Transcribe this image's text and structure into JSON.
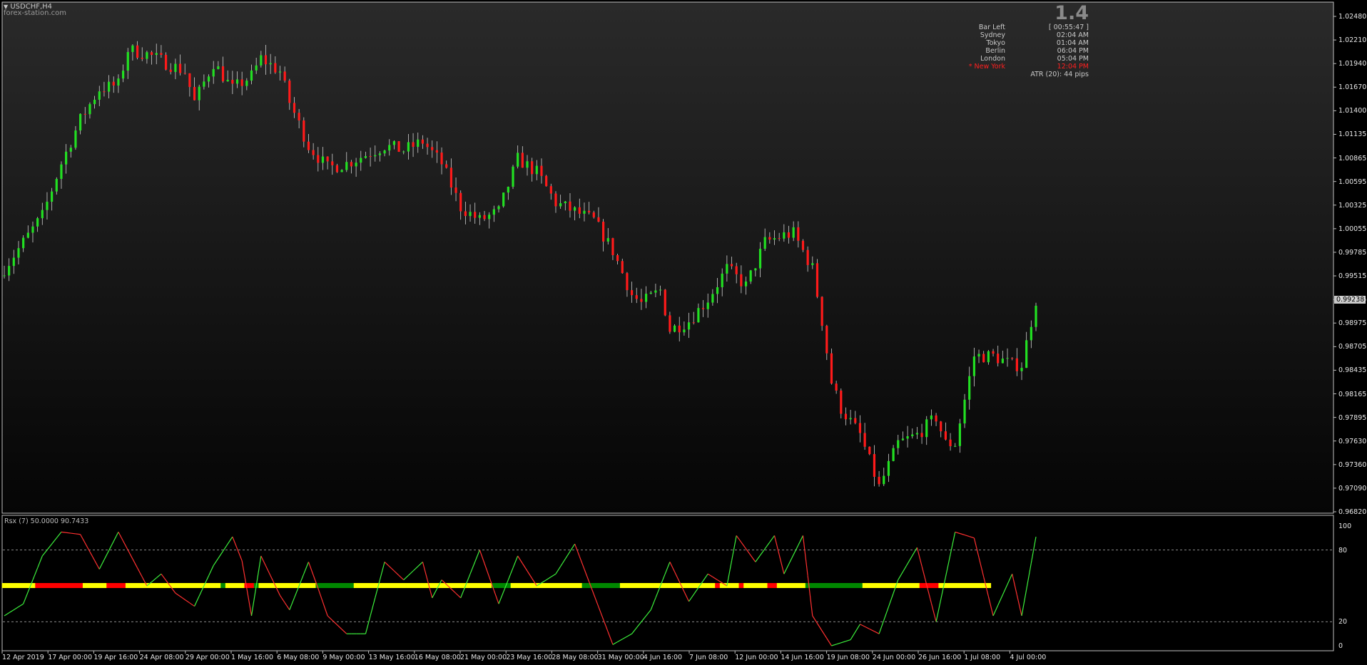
{
  "symbol_title": "USDCHF,H4",
  "watermark": "forex-station.com",
  "spread_value": "1.4",
  "info_panel": {
    "bar_left_label": "Bar Left",
    "bar_left_value": "[ 00:55:47 ]",
    "sessions": [
      {
        "city": "Sydney",
        "time": "02:04 AM",
        "active": false
      },
      {
        "city": "Tokyo",
        "time": "01:04 AM",
        "active": false
      },
      {
        "city": "Berlin",
        "time": "06:04 PM",
        "active": false
      },
      {
        "city": "London",
        "time": "05:04 PM",
        "active": false
      },
      {
        "city": "* New York",
        "time": "12:04 PM",
        "active": true
      }
    ],
    "atr_text": "ATR (20): 44 pips"
  },
  "price_axis": [
    "1.02480",
    "1.02210",
    "1.01940",
    "1.01670",
    "1.01400",
    "1.01135",
    "1.00865",
    "1.00595",
    "1.00325",
    "1.00055",
    "0.99785",
    "0.99515",
    "0.99245",
    "0.98975",
    "0.98705",
    "0.98435",
    "0.98165",
    "0.97895",
    "0.97630",
    "0.97360",
    "0.97090",
    "0.96820"
  ],
  "current_price": "0.99238",
  "indicator": {
    "label": "Rsx (7) 50.0000 90.7433",
    "levels": [
      "100",
      "80",
      "20",
      "0"
    ]
  },
  "time_axis": [
    "12 Apr 2019",
    "17 Apr 00:00",
    "19 Apr 16:00",
    "24 Apr 08:00",
    "29 Apr 00:00",
    "1 May 16:00",
    "6 May 08:00",
    "9 May 00:00",
    "13 May 16:00",
    "16 May 08:00",
    "21 May 00:00",
    "23 May 16:00",
    "28 May 08:00",
    "31 May 00:00",
    "4 Jun 16:00",
    "7 Jun 08:00",
    "12 Jun 00:00",
    "14 Jun 16:00",
    "19 Jun 08:00",
    "24 Jun 00:00",
    "26 Jun 16:00",
    "1 Jul 08:00",
    "4 Jul 00:00"
  ],
  "colors": {
    "bull": "#22e022",
    "bear": "#ff1a1a",
    "rsx_up": "#3cf03c",
    "rsx_down": "#ff3030",
    "ribbon_yellow": "#ffff00",
    "ribbon_red": "#ff0000",
    "ribbon_green": "#008800"
  },
  "chart_data": {
    "type": "candlestick",
    "ylim": [
      0.9682,
      1.0248
    ],
    "close_path": [
      [
        0,
        0.996
      ],
      [
        4,
        0.999
      ],
      [
        8,
        1.002
      ],
      [
        12,
        1.008
      ],
      [
        16,
        1.013
      ],
      [
        20,
        1.0165
      ],
      [
        24,
        1.017
      ],
      [
        26,
        1.021
      ],
      [
        30,
        1.0205
      ],
      [
        34,
        1.0195
      ],
      [
        38,
        1.0185
      ],
      [
        40,
        1.015
      ],
      [
        44,
        1.0195
      ],
      [
        48,
        1.0165
      ],
      [
        52,
        1.018
      ],
      [
        54,
        1.02
      ],
      [
        58,
        1.0185
      ],
      [
        60,
        1.015
      ],
      [
        64,
        1.01
      ],
      [
        68,
        1.0075
      ],
      [
        72,
        1.008
      ],
      [
        76,
        1.009
      ],
      [
        80,
        1.01
      ],
      [
        84,
        1.0095
      ],
      [
        88,
        1.0105
      ],
      [
        92,
        1.008
      ],
      [
        96,
        1.003
      ],
      [
        100,
        1.0015
      ],
      [
        104,
        1.0025
      ],
      [
        108,
        1.0085
      ],
      [
        112,
        1.007
      ],
      [
        116,
        1.0035
      ],
      [
        120,
        1.0025
      ],
      [
        124,
        1.0015
      ],
      [
        128,
        0.998
      ],
      [
        132,
        0.993
      ],
      [
        134,
        0.992
      ],
      [
        138,
        0.9935
      ],
      [
        140,
        0.989
      ],
      [
        144,
        0.99
      ],
      [
        148,
        0.9925
      ],
      [
        152,
        0.996
      ],
      [
        156,
        0.994
      ],
      [
        160,
        0.999
      ],
      [
        164,
        0.9998
      ],
      [
        166,
        1.0
      ],
      [
        170,
        0.996
      ],
      [
        172,
        0.99
      ],
      [
        174,
        0.983
      ],
      [
        176,
        0.98
      ],
      [
        180,
        0.977
      ],
      [
        182,
        0.974
      ],
      [
        184,
        0.971
      ],
      [
        188,
        0.976
      ],
      [
        192,
        0.977
      ],
      [
        196,
        0.979
      ],
      [
        198,
        0.976
      ],
      [
        200,
        0.976
      ],
      [
        204,
        0.986
      ],
      [
        208,
        0.986
      ],
      [
        212,
        0.985
      ],
      [
        214,
        0.985
      ],
      [
        217,
        0.9924
      ]
    ],
    "bars": 218,
    "rsx": [
      [
        0,
        25
      ],
      [
        4,
        35
      ],
      [
        8,
        75
      ],
      [
        12,
        95
      ],
      [
        16,
        93
      ],
      [
        20,
        64
      ],
      [
        24,
        95
      ],
      [
        26,
        80
      ],
      [
        30,
        50
      ],
      [
        33,
        60
      ],
      [
        36,
        44
      ],
      [
        40,
        33
      ],
      [
        44,
        67
      ],
      [
        48,
        91
      ],
      [
        50,
        71
      ],
      [
        52,
        25
      ],
      [
        54,
        75
      ],
      [
        58,
        42
      ],
      [
        60,
        30
      ],
      [
        64,
        70
      ],
      [
        66,
        48
      ],
      [
        68,
        25
      ],
      [
        72,
        10
      ],
      [
        76,
        10
      ],
      [
        80,
        70
      ],
      [
        84,
        55
      ],
      [
        88,
        70
      ],
      [
        90,
        40
      ],
      [
        92,
        55
      ],
      [
        96,
        40
      ],
      [
        100,
        80
      ],
      [
        104,
        35
      ],
      [
        108,
        75
      ],
      [
        112,
        50
      ],
      [
        116,
        60
      ],
      [
        120,
        85
      ],
      [
        124,
        43
      ],
      [
        128,
        1
      ],
      [
        132,
        10
      ],
      [
        136,
        30
      ],
      [
        140,
        70
      ],
      [
        144,
        37
      ],
      [
        148,
        60
      ],
      [
        152,
        50
      ],
      [
        154,
        92
      ],
      [
        158,
        70
      ],
      [
        162,
        92
      ],
      [
        164,
        60
      ],
      [
        168,
        92
      ],
      [
        170,
        25
      ],
      [
        174,
        0
      ],
      [
        178,
        5
      ],
      [
        180,
        18
      ],
      [
        184,
        10
      ],
      [
        188,
        55
      ],
      [
        192,
        82
      ],
      [
        196,
        20
      ],
      [
        200,
        95
      ],
      [
        204,
        90
      ],
      [
        208,
        25
      ],
      [
        212,
        60
      ],
      [
        214,
        25
      ],
      [
        217,
        91
      ]
    ],
    "ribbon": [
      "Y",
      "Y",
      "Y",
      "Y",
      "Y",
      "Y",
      "Y",
      "R",
      "R",
      "R",
      "R",
      "R",
      "R",
      "R",
      "R",
      "R",
      "R",
      "Y",
      "Y",
      "Y",
      "Y",
      "Y",
      "R",
      "R",
      "R",
      "R",
      "Y",
      "Y",
      "Y",
      "Y",
      "Y",
      "Y",
      "Y",
      "Y",
      "Y",
      "Y",
      "Y",
      "Y",
      "Y",
      "Y",
      "Y",
      "Y",
      "Y",
      "Y",
      "Y",
      "Y",
      "G",
      "Y",
      "Y",
      "Y",
      "Y",
      "R",
      "R",
      "G",
      "Y",
      "Y",
      "Y",
      "Y",
      "Y",
      "Y",
      "Y",
      "Y",
      "Y",
      "Y",
      "Y",
      "Y",
      "G",
      "G",
      "G",
      "G",
      "G",
      "G",
      "G",
      "G",
      "Y",
      "Y",
      "Y",
      "Y",
      "Y",
      "Y",
      "Y",
      "Y",
      "Y",
      "Y",
      "Y",
      "Y",
      "Y",
      "Y",
      "Y",
      "Y",
      "Y",
      "Y",
      "Y",
      "Y",
      "Y",
      "Y",
      "Y",
      "Y",
      "Y",
      "Y",
      "Y",
      "Y",
      "Y",
      "G",
      "G",
      "G",
      "G",
      "Y",
      "Y",
      "Y",
      "Y",
      "Y",
      "Y",
      "Y",
      "Y",
      "Y",
      "Y",
      "Y",
      "Y",
      "Y",
      "Y",
      "Y",
      "G",
      "G",
      "G",
      "G",
      "G",
      "G",
      "G",
      "G",
      "Y",
      "Y",
      "Y",
      "Y",
      "Y",
      "Y",
      "Y",
      "Y",
      "Y",
      "Y",
      "Y",
      "Y",
      "Y",
      "Y",
      "Y",
      "Y",
      "Y",
      "Y",
      "Y",
      "Y",
      "R",
      "Y",
      "Y",
      "Y",
      "Y",
      "R",
      "Y",
      "Y",
      "Y",
      "Y",
      "Y",
      "R",
      "R",
      "Y",
      "Y",
      "Y",
      "Y",
      "Y",
      "Y",
      "G",
      "G",
      "G",
      "G",
      "G",
      "G",
      "G",
      "G",
      "G",
      "G",
      "G",
      "G",
      "Y",
      "Y",
      "Y",
      "Y",
      "Y",
      "Y",
      "Y",
      "Y",
      "Y",
      "Y",
      "Y",
      "Y",
      "R",
      "R",
      "R",
      "R",
      "Y",
      "Y",
      "Y",
      "Y",
      "Y",
      "Y",
      "Y",
      "Y",
      "Y",
      "Y",
      "Y"
    ]
  }
}
